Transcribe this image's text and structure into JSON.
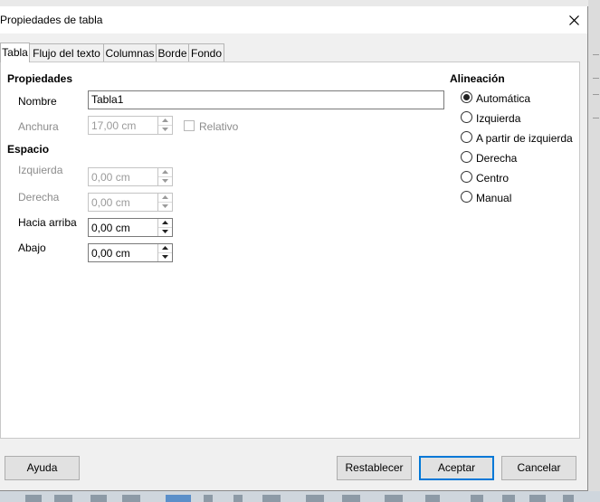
{
  "dialog": {
    "title": "Propiedades de tabla",
    "close_glyph": "✕"
  },
  "tabs": [
    {
      "label": "Tabla",
      "active": true
    },
    {
      "label": "Flujo del texto",
      "active": false
    },
    {
      "label": "Columnas",
      "active": false
    },
    {
      "label": "Borde",
      "active": false
    },
    {
      "label": "Fondo",
      "active": false
    }
  ],
  "properties": {
    "heading": "Propiedades",
    "name_label": "Nombre",
    "name_value": "Tabla1",
    "width_label": "Anchura",
    "width_value": "17,00 cm",
    "relative_label": "Relativo",
    "relative_checked": false
  },
  "spacing": {
    "heading": "Espacio",
    "left_label": "Izquierda",
    "left_value": "0,00 cm",
    "right_label": "Derecha",
    "right_value": "0,00 cm",
    "above_label": "Hacia arriba",
    "above_value": "0,00 cm",
    "below_label": "Abajo",
    "below_value": "0,00 cm"
  },
  "alignment": {
    "heading": "Alineación",
    "options": [
      {
        "label": "Automática",
        "checked": true
      },
      {
        "label": "Izquierda",
        "checked": false
      },
      {
        "label": "A partir de izquierda",
        "checked": false
      },
      {
        "label": "Derecha",
        "checked": false
      },
      {
        "label": "Centro",
        "checked": false
      },
      {
        "label": "Manual",
        "checked": false
      }
    ]
  },
  "buttons": {
    "help": "Ayuda",
    "reset": "Restablecer",
    "ok": "Aceptar",
    "cancel": "Cancelar"
  },
  "colors": {
    "default_button_border": "#0078d7",
    "disabled_text": "#8c8c8c"
  }
}
